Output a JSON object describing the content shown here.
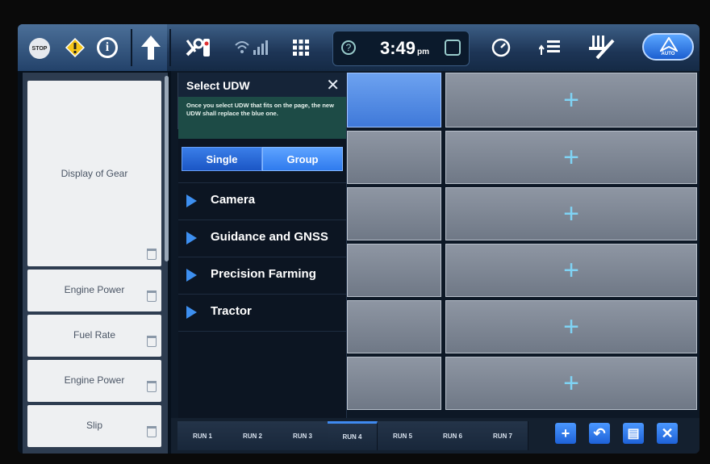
{
  "status_bar": {
    "stop_label": "STOP",
    "time": "3:49",
    "ampm": "pm",
    "auto_label": "AUTO",
    "icons": [
      "stop-icon",
      "warning-icon",
      "info-icon",
      "up-arrow-icon",
      "wrench-icon",
      "signal-icon",
      "grid-icon",
      "help-icon",
      "user-icon",
      "gauge-icon",
      "arrow-bars-icon",
      "implement-icon",
      "auto-steer-icon"
    ]
  },
  "left_panel": {
    "items": [
      {
        "label": "Display of Gear"
      },
      {
        "label": "Engine Power"
      },
      {
        "label": "Fuel Rate"
      },
      {
        "label": "Engine Power"
      },
      {
        "label": "Slip"
      }
    ]
  },
  "popup": {
    "title": "Select UDW",
    "close": "✕",
    "message": "Once you select UDW that fits on the page, the new UDW shall replace the blue one.",
    "tabs": {
      "single": "Single",
      "group": "Group"
    },
    "categories": [
      "Camera",
      "Guidance and GNSS",
      "Precision Farming",
      "Tractor"
    ]
  },
  "grid": {
    "plus": "+"
  },
  "bottom_bar": {
    "runs": [
      "RUN 1",
      "RUN 2",
      "RUN 3",
      "RUN 4",
      "RUN 5",
      "RUN 6",
      "RUN 7"
    ],
    "active_run": "RUN 4",
    "buttons": {
      "add": "+",
      "undo": "↶",
      "layout": "▤",
      "close": "✕"
    }
  },
  "colors": {
    "accent": "#2f7bee",
    "message_bg": "#1d4b46"
  }
}
